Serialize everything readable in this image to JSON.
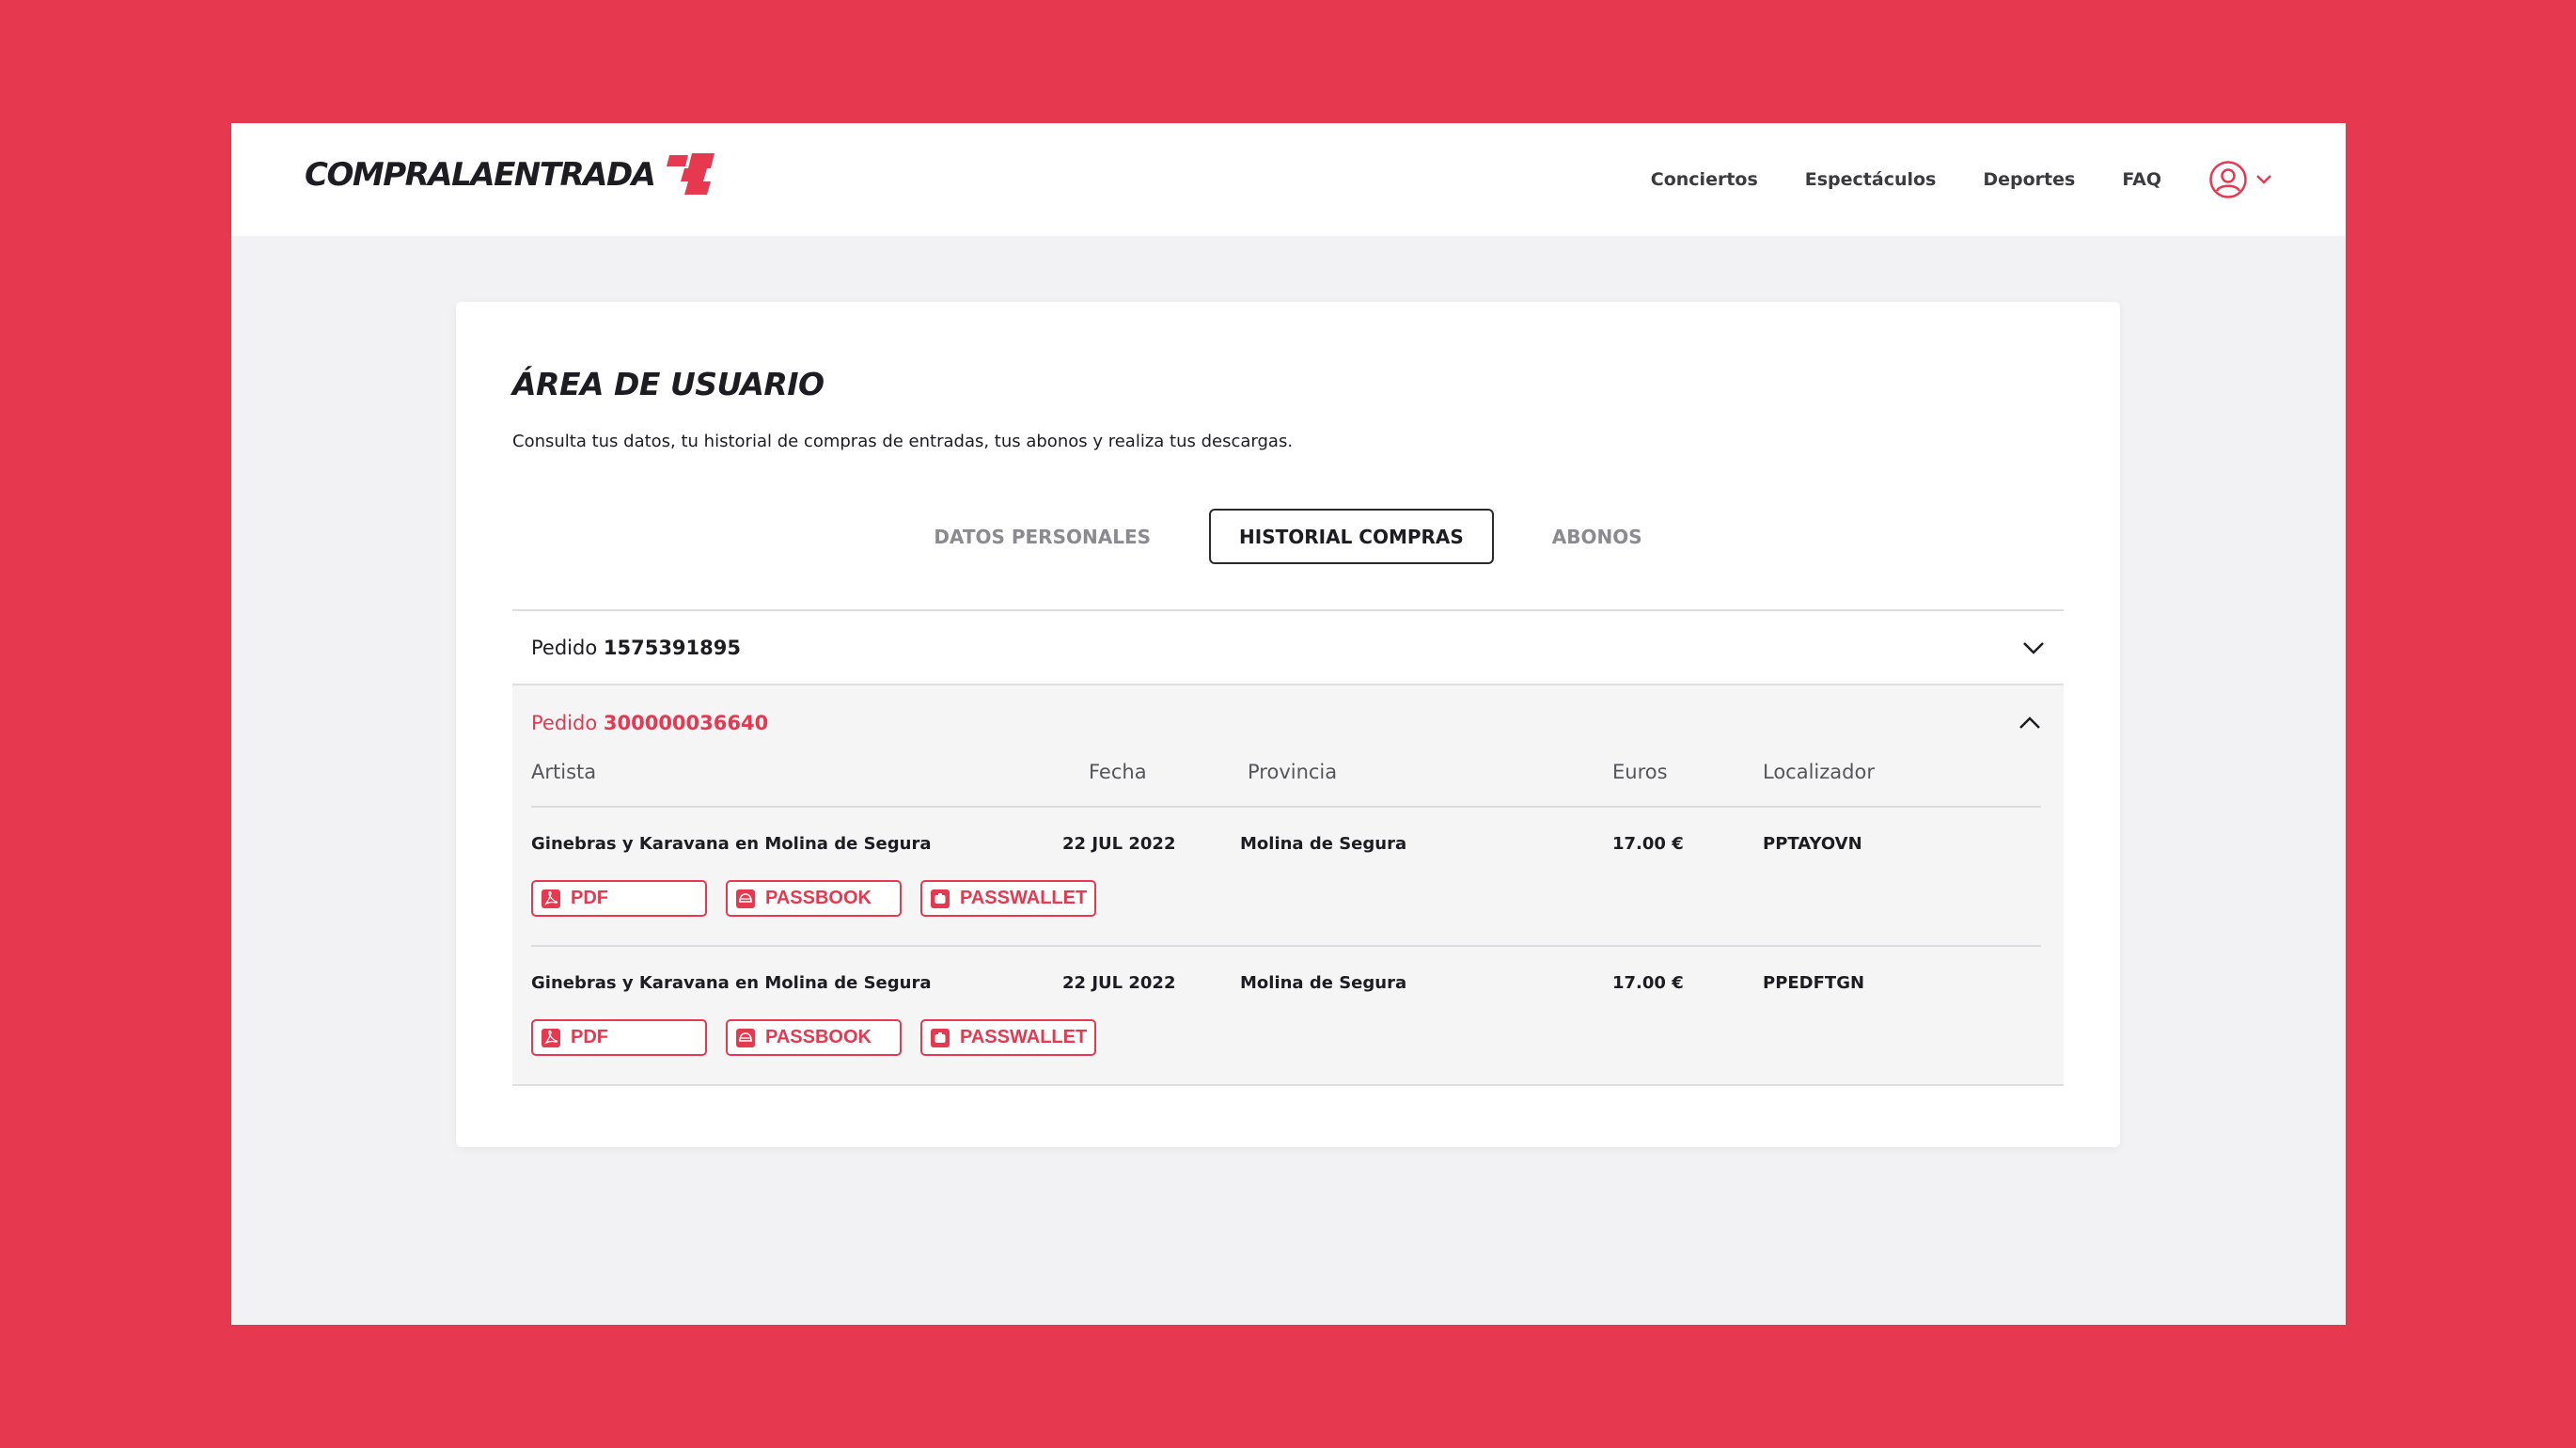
{
  "header": {
    "logo_text": "COMPRALAENTRADA",
    "nav": [
      "Conciertos",
      "Espectáculos",
      "Deportes",
      "FAQ"
    ]
  },
  "page": {
    "title": "ÁREA DE USUARIO",
    "description": "Consulta tus datos, tu historial de compras de entradas, tus abonos y realiza tus descargas."
  },
  "tabs": [
    "DATOS PERSONALES",
    "HISTORIAL COMPRAS",
    "ABONOS"
  ],
  "active_tab": "HISTORIAL COMPRAS",
  "orders": [
    {
      "label": "Pedido",
      "number": "1575391895"
    },
    {
      "label": "Pedido",
      "number": "300000036640"
    }
  ],
  "table": {
    "columns": [
      "Artista",
      "Fecha",
      "Provincia",
      "Euros",
      "Localizador"
    ],
    "rows": [
      {
        "artist": "Ginebras y Karavana en Molina de Segura",
        "date": "22 JUL 2022",
        "province": "Molina de Segura",
        "euros": "17.00 €",
        "locator": "PPTAYOVN"
      },
      {
        "artist": "Ginebras y Karavana en Molina de Segura",
        "date": "22 JUL 2022",
        "province": "Molina de Segura",
        "euros": "17.00 €",
        "locator": "PPEDFTGN"
      }
    ],
    "buttons": {
      "pdf": "PDF",
      "passbook": "PASSBOOK",
      "passwallet": "PASSWALLET"
    }
  },
  "colors": {
    "brand": "#e6394f",
    "dark": "#1c1c22",
    "panel": "#f2f2f4"
  },
  "icons": [
    "user-icon",
    "chevron-down-icon",
    "chevron-up-icon",
    "pdf-icon",
    "passbook-icon",
    "passwallet-icon"
  ]
}
